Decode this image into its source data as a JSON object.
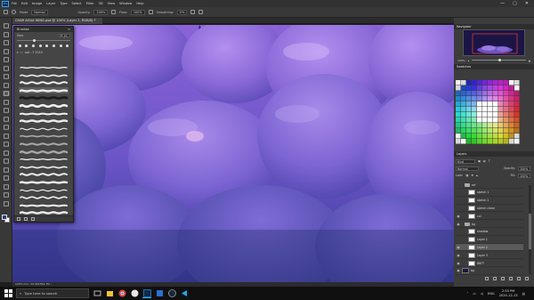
{
  "menubar": {
    "app_badge": "Ps",
    "items": [
      "File",
      "Edit",
      "Image",
      "Layer",
      "Type",
      "Select",
      "Filter",
      "3D",
      "View",
      "Window",
      "Help"
    ],
    "win_controls": [
      "—",
      "▢",
      "✕"
    ]
  },
  "options": {
    "brush_size": "Mode",
    "mode_value": "Normal",
    "opacity_label": "Opacity:",
    "opacity_value": "100%",
    "flow_label": "Flow:",
    "flow_value": "100%",
    "smoothing_label": "Smoothing:",
    "smoothing_value": "0%"
  },
  "document": {
    "tab_title": "CHAR AGUA WING.psd @ 100% (Layer 2, RGB/8) *",
    "close": "×",
    "status": "100%    Doc: 26.9M/364.7M  ›"
  },
  "brush_panel": {
    "title": "Brushes",
    "menu_glyph": "≡",
    "size_label": "Size:",
    "size_value": "21 px",
    "group_label": "Lab - Y 2019"
  },
  "navigator": {
    "title": "Navigator",
    "zoom": "100%"
  },
  "swatches": {
    "title": "Swatches"
  },
  "layers": {
    "title": "Layers",
    "kind_label": "Kind",
    "blend_mode": "Normal",
    "opacity_label": "Opacity:",
    "opacity_value": "100%",
    "lock_label": "Lock:",
    "fill_label": "Fill:",
    "fill_value": "100%",
    "rows": [
      {
        "name": "ref",
        "type": "folder",
        "visible": false,
        "selected": false
      },
      {
        "name": "sketch 1",
        "type": "layer",
        "visible": false,
        "selected": false
      },
      {
        "name": "sketch 2",
        "type": "layer",
        "visible": false,
        "selected": false
      },
      {
        "name": "sketch clean",
        "type": "layer",
        "visible": false,
        "selected": false
      },
      {
        "name": "col",
        "type": "layer",
        "visible": true,
        "selected": false
      },
      {
        "name": "bg",
        "type": "folder",
        "visible": true,
        "selected": false
      },
      {
        "name": "shadow",
        "type": "layer",
        "visible": false,
        "selected": false
      },
      {
        "name": "Layer 1",
        "type": "layer",
        "visible": false,
        "selected": false
      },
      {
        "name": "Layer 2",
        "type": "layer",
        "visible": true,
        "selected": true
      },
      {
        "name": "Layer 3",
        "type": "layer",
        "visible": true,
        "selected": false
      },
      {
        "name": "BKFT",
        "type": "layer",
        "visible": true,
        "selected": false
      },
      {
        "name": "bg",
        "type": "layer",
        "visible": true,
        "selected": false
      }
    ]
  },
  "taskbar": {
    "search_placeholder": "Type here to search",
    "lang": "ENG",
    "time": "2:55 PM",
    "date": "2020-12-13"
  },
  "colors": {
    "accent": "#31a8ff",
    "canvas_base": "#6f57c9",
    "foreground_swatch": "#2d3d8a",
    "background_swatch": "#ffffff"
  }
}
